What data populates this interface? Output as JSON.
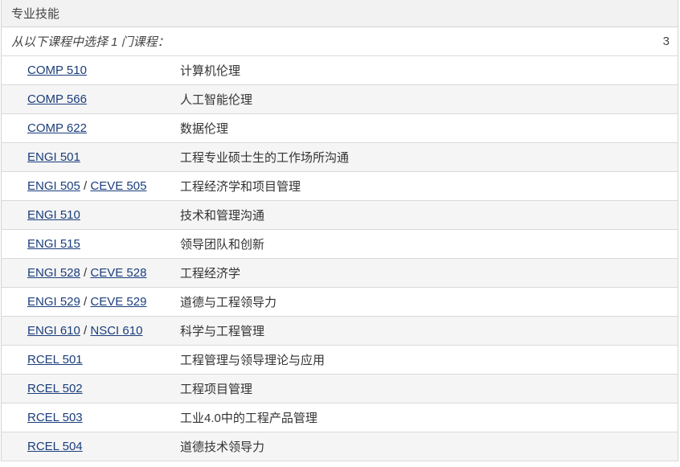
{
  "header": {
    "title": "专业技能"
  },
  "select_row": {
    "label": "从以下课程中选择 1 门课程：",
    "hours": "3"
  },
  "courses": [
    {
      "codes": [
        "COMP 510"
      ],
      "title": "计算机伦理"
    },
    {
      "codes": [
        "COMP 566"
      ],
      "title": "人工智能伦理"
    },
    {
      "codes": [
        "COMP 622"
      ],
      "title": "数据伦理"
    },
    {
      "codes": [
        "ENGI 501"
      ],
      "title": "工程专业硕士生的工作场所沟通"
    },
    {
      "codes": [
        "ENGI 505",
        "CEVE 505"
      ],
      "title": "工程经济学和项目管理"
    },
    {
      "codes": [
        "ENGI 510"
      ],
      "title": "技术和管理沟通"
    },
    {
      "codes": [
        "ENGI 515"
      ],
      "title": "领导团队和创新"
    },
    {
      "codes": [
        "ENGI 528",
        "CEVE 528"
      ],
      "title": "工程经济学"
    },
    {
      "codes": [
        "ENGI 529",
        "CEVE 529"
      ],
      "title": "道德与工程领导力"
    },
    {
      "codes": [
        "ENGI 610",
        "NSCI 610"
      ],
      "title": "科学与工程管理"
    },
    {
      "codes": [
        "RCEL 501"
      ],
      "title": "工程管理与领导理论与应用"
    },
    {
      "codes": [
        "RCEL 502"
      ],
      "title": "工程项目管理"
    },
    {
      "codes": [
        "RCEL 503"
      ],
      "title": "工业4.0中的工程产品管理"
    },
    {
      "codes": [
        "RCEL 504"
      ],
      "title": "道德技术领导力"
    }
  ],
  "code_separator": " / "
}
